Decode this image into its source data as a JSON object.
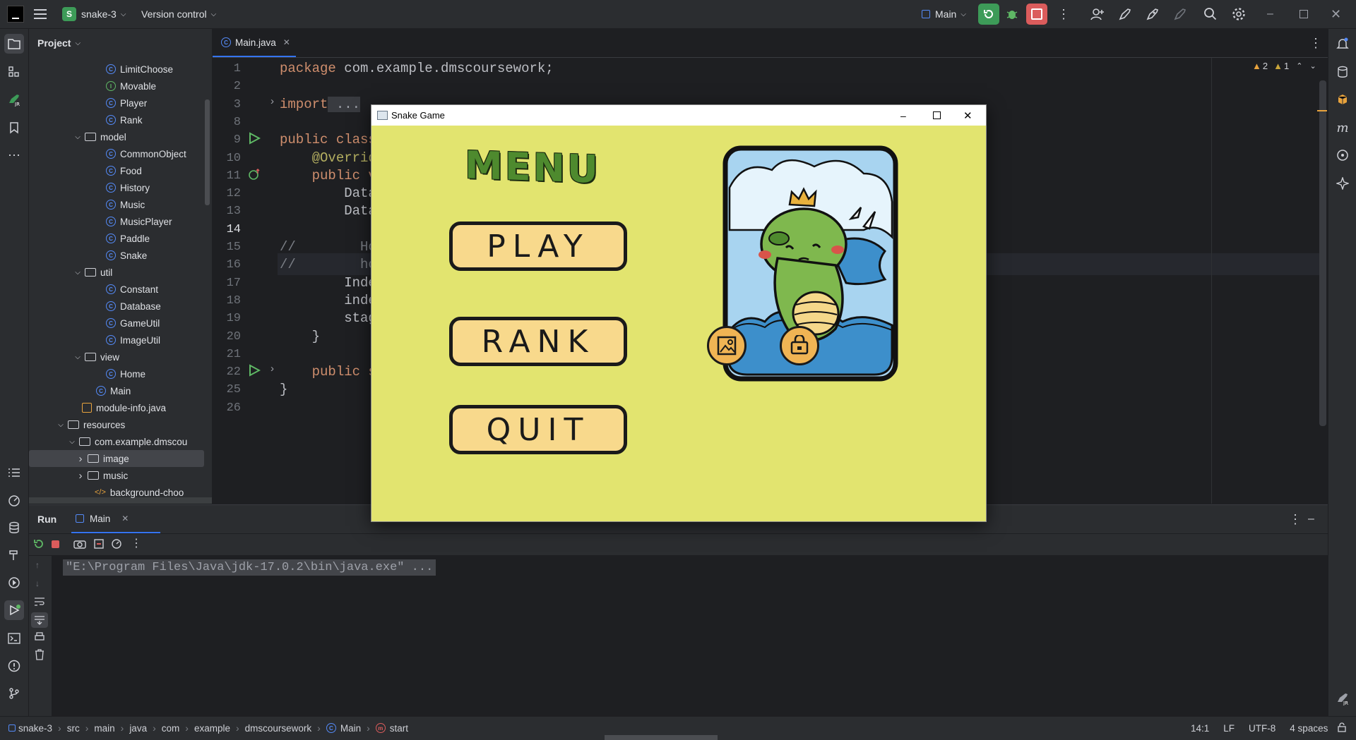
{
  "titlebar": {
    "project_badge": "S",
    "project_name": "snake-3",
    "vcs_label": "Version control",
    "run_config": "Main"
  },
  "project_panel": {
    "title": "Project",
    "items": [
      {
        "label": "LimitChoose",
        "kind": "class"
      },
      {
        "label": "Movable",
        "kind": "interface"
      },
      {
        "label": "Player",
        "kind": "class"
      },
      {
        "label": "Rank",
        "kind": "class"
      },
      {
        "label": "model",
        "kind": "package"
      },
      {
        "label": "CommonObject",
        "kind": "class"
      },
      {
        "label": "Food",
        "kind": "class"
      },
      {
        "label": "History",
        "kind": "class"
      },
      {
        "label": "Music",
        "kind": "class"
      },
      {
        "label": "MusicPlayer",
        "kind": "class"
      },
      {
        "label": "Paddle",
        "kind": "class"
      },
      {
        "label": "Snake",
        "kind": "class"
      },
      {
        "label": "util",
        "kind": "package"
      },
      {
        "label": "Constant",
        "kind": "class"
      },
      {
        "label": "Database",
        "kind": "class"
      },
      {
        "label": "GameUtil",
        "kind": "class"
      },
      {
        "label": "ImageUtil",
        "kind": "class"
      },
      {
        "label": "view",
        "kind": "package"
      },
      {
        "label": "Home",
        "kind": "class"
      },
      {
        "label": "Main",
        "kind": "class"
      },
      {
        "label": "module-info.java",
        "kind": "file"
      },
      {
        "label": "resources",
        "kind": "folder"
      },
      {
        "label": "com.example.dmscou",
        "kind": "package"
      },
      {
        "label": "image",
        "kind": "folder"
      },
      {
        "label": "music",
        "kind": "folder"
      },
      {
        "label": "background-choo",
        "kind": "fxml"
      }
    ]
  },
  "editor": {
    "tab_label": "Main.java",
    "warnings": "2",
    "weak_warnings": "1",
    "line_numbers": [
      "1",
      "2",
      "3",
      "8",
      "9",
      "10",
      "11",
      "12",
      "13",
      "14",
      "15",
      "16",
      "17",
      "18",
      "19",
      "20",
      "21",
      "22",
      "25",
      "26"
    ],
    "lines": [
      {
        "kw": "package",
        "text": " com.example.dmscoursework;"
      },
      {
        "kw": "",
        "text": ""
      },
      {
        "kw": "import",
        "text": " ..."
      },
      {
        "kw": "",
        "text": ""
      },
      {
        "kw": "public class",
        "text": ""
      },
      {
        "kw": "",
        "text": "    @Overrid"
      },
      {
        "kw": "",
        "text": "    public v"
      },
      {
        "kw": "",
        "text": "        Data"
      },
      {
        "kw": "",
        "text": "        Data"
      },
      {
        "kw": "",
        "text": ""
      },
      {
        "kw": "",
        "text": "//        Ho"
      },
      {
        "kw": "",
        "text": "//        ho"
      },
      {
        "kw": "",
        "text": "        Inde"
      },
      {
        "kw": "",
        "text": "        inde"
      },
      {
        "kw": "",
        "text": "        stag"
      },
      {
        "kw": "",
        "text": "    }"
      },
      {
        "kw": "",
        "text": ""
      },
      {
        "kw": "",
        "text": "    public s"
      },
      {
        "kw": "",
        "text": "}"
      },
      {
        "kw": "",
        "text": ""
      }
    ]
  },
  "game_window": {
    "title": "Snake Game",
    "menu_heading": "MENU",
    "buttons": [
      "PLAY",
      "RANK",
      "QUIT"
    ]
  },
  "run_panel": {
    "title": "Run",
    "tab_label": "Main",
    "console_line": "\"E:\\Program Files\\Java\\jdk-17.0.2\\bin\\java.exe\" ..."
  },
  "status_bar": {
    "breadcrumbs": [
      "snake-3",
      "src",
      "main",
      "java",
      "com",
      "example",
      "dmscoursework",
      "Main",
      "start"
    ],
    "position": "14:1",
    "line_ending": "LF",
    "encoding": "UTF-8",
    "indent": "4 spaces"
  },
  "colors": {
    "ide_bg": "#1e1f22",
    "panel_bg": "#2b2d30",
    "game_bg": "#e2e46f",
    "button_fill": "#f8d98c",
    "menu_green": "#4e8a2e",
    "run_green": "#3d9b58",
    "stop_red": "#db5c5c"
  }
}
